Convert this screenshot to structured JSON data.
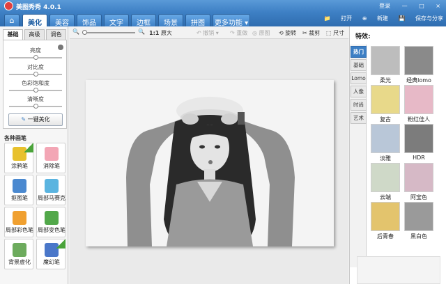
{
  "window": {
    "title": "美图秀秀 4.0.1",
    "login": "登录",
    "controls": [
      "—",
      "□",
      "×"
    ]
  },
  "tabs": [
    {
      "label": "",
      "icon": "home-icon"
    },
    {
      "label": "美化",
      "active": true
    },
    {
      "label": "美容"
    },
    {
      "label": "饰品"
    },
    {
      "label": "文字"
    },
    {
      "label": "边框"
    },
    {
      "label": "场景"
    },
    {
      "label": "拼图"
    },
    {
      "label": "更多功能 ▾"
    }
  ],
  "header_actions": {
    "open": "打开",
    "new": "新建",
    "save": "保存与分享"
  },
  "left": {
    "subtabs": [
      "基础",
      "高级",
      "调色"
    ],
    "sliders": [
      {
        "label": "亮度",
        "value": 0.5
      },
      {
        "label": "对比度",
        "value": 0.5
      },
      {
        "label": "色彩饱和度",
        "value": 0.5
      },
      {
        "label": "清晰度",
        "value": 0.5
      }
    ],
    "one_click": "一键美化",
    "pens_title": "各种画笔",
    "pens": [
      {
        "label": "涂鸦笔",
        "color": "#e8c12d",
        "badge": true
      },
      {
        "label": "消除笔",
        "color": "#f3a6b5"
      },
      {
        "label": "抠图笔",
        "color": "#4a89d0"
      },
      {
        "label": "局部马赛克",
        "color": "#5ab4e0"
      },
      {
        "label": "局部彩色笔",
        "color": "#f0a030"
      },
      {
        "label": "局部变色笔",
        "color": "#52a84a"
      },
      {
        "label": "背景虚化",
        "color": "#6dab5d"
      },
      {
        "label": "魔幻笔",
        "color": "#4a77c9",
        "badge": true
      }
    ]
  },
  "toolbar": {
    "zoom_level": 0,
    "ratio": "1:1",
    "original": "原大",
    "undo": "撤销",
    "redo": "重做",
    "restore": "原图",
    "rotate": "旋转",
    "crop": "裁剪",
    "size": "尺寸"
  },
  "right": {
    "title": "特效:",
    "categories": [
      {
        "label": "热门",
        "active": true
      },
      {
        "label": "基础"
      },
      {
        "label": "Lomo"
      },
      {
        "label": "人像"
      },
      {
        "label": "时尚"
      },
      {
        "label": "艺术"
      }
    ],
    "effects": [
      {
        "label": "柔光",
        "tint": "#bdbdbd"
      },
      {
        "label": "经典lomo",
        "tint": "#8a8a8a"
      },
      {
        "label": "复古",
        "tint": "#e8d98a"
      },
      {
        "label": "粉红佳人",
        "tint": "#e7b9c7"
      },
      {
        "label": "淡雅",
        "tint": "#b9c7d8"
      },
      {
        "label": "HDR",
        "tint": "#7c7c7c"
      },
      {
        "label": "云端",
        "tint": "#cfd9c8"
      },
      {
        "label": "阿宝色",
        "tint": "#d6b9c6"
      },
      {
        "label": "后青春",
        "tint": "#e3c46d"
      },
      {
        "label": "黑白色",
        "tint": "#9a9a9a"
      }
    ]
  }
}
